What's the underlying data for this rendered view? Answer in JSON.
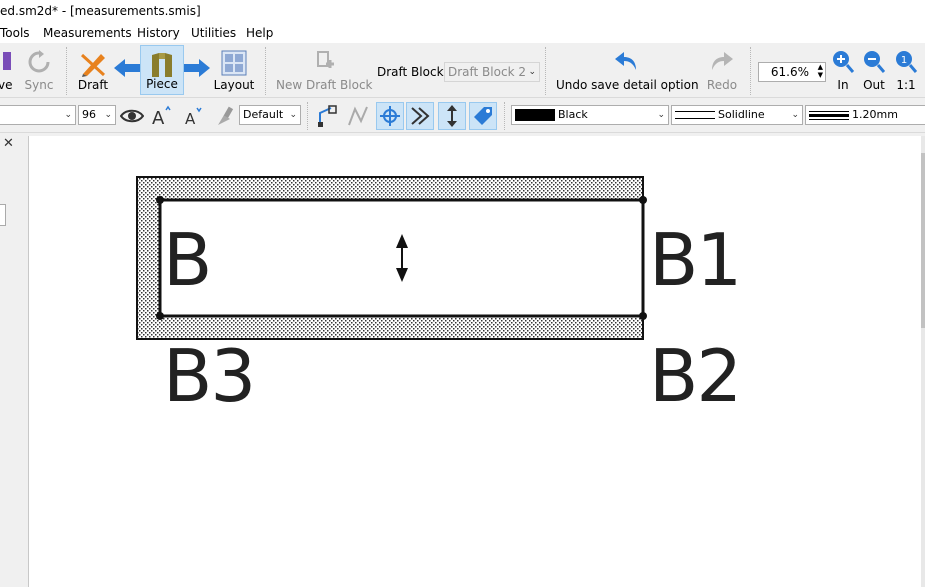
{
  "window": {
    "title": "ed.sm2d* - [measurements.smis]"
  },
  "menu": {
    "items": [
      "Tools",
      "Measurements",
      "History",
      "Utilities",
      "Help"
    ]
  },
  "toolbar": {
    "save_partial": "ve",
    "sync": "Sync",
    "draft": "Draft",
    "piece": "Piece",
    "layout": "Layout",
    "new_draft_block": "New Draft Block",
    "draft_block_label": "Draft Block:",
    "draft_block_value": "Draft Block 2",
    "undo": "Undo save detail option",
    "redo": "Redo",
    "zoom_value": "61.6%",
    "zoom_in": "In",
    "zoom_out": "Out",
    "zoom_1to1": "1:1"
  },
  "toolbar2": {
    "font_size": "96",
    "text_style": "Default",
    "color_name": "Black",
    "line_type": "Solidline",
    "line_weight": "1.20mm"
  },
  "canvas": {
    "labels": {
      "b": "B",
      "b1": "B1",
      "b2": "B2",
      "b3": "B3"
    }
  },
  "colors": {
    "accent": "#2b7bd6",
    "active_bg": "#cce4f7",
    "draft_orange": "#e8821e",
    "piece_olive": "#8a7d2c"
  }
}
